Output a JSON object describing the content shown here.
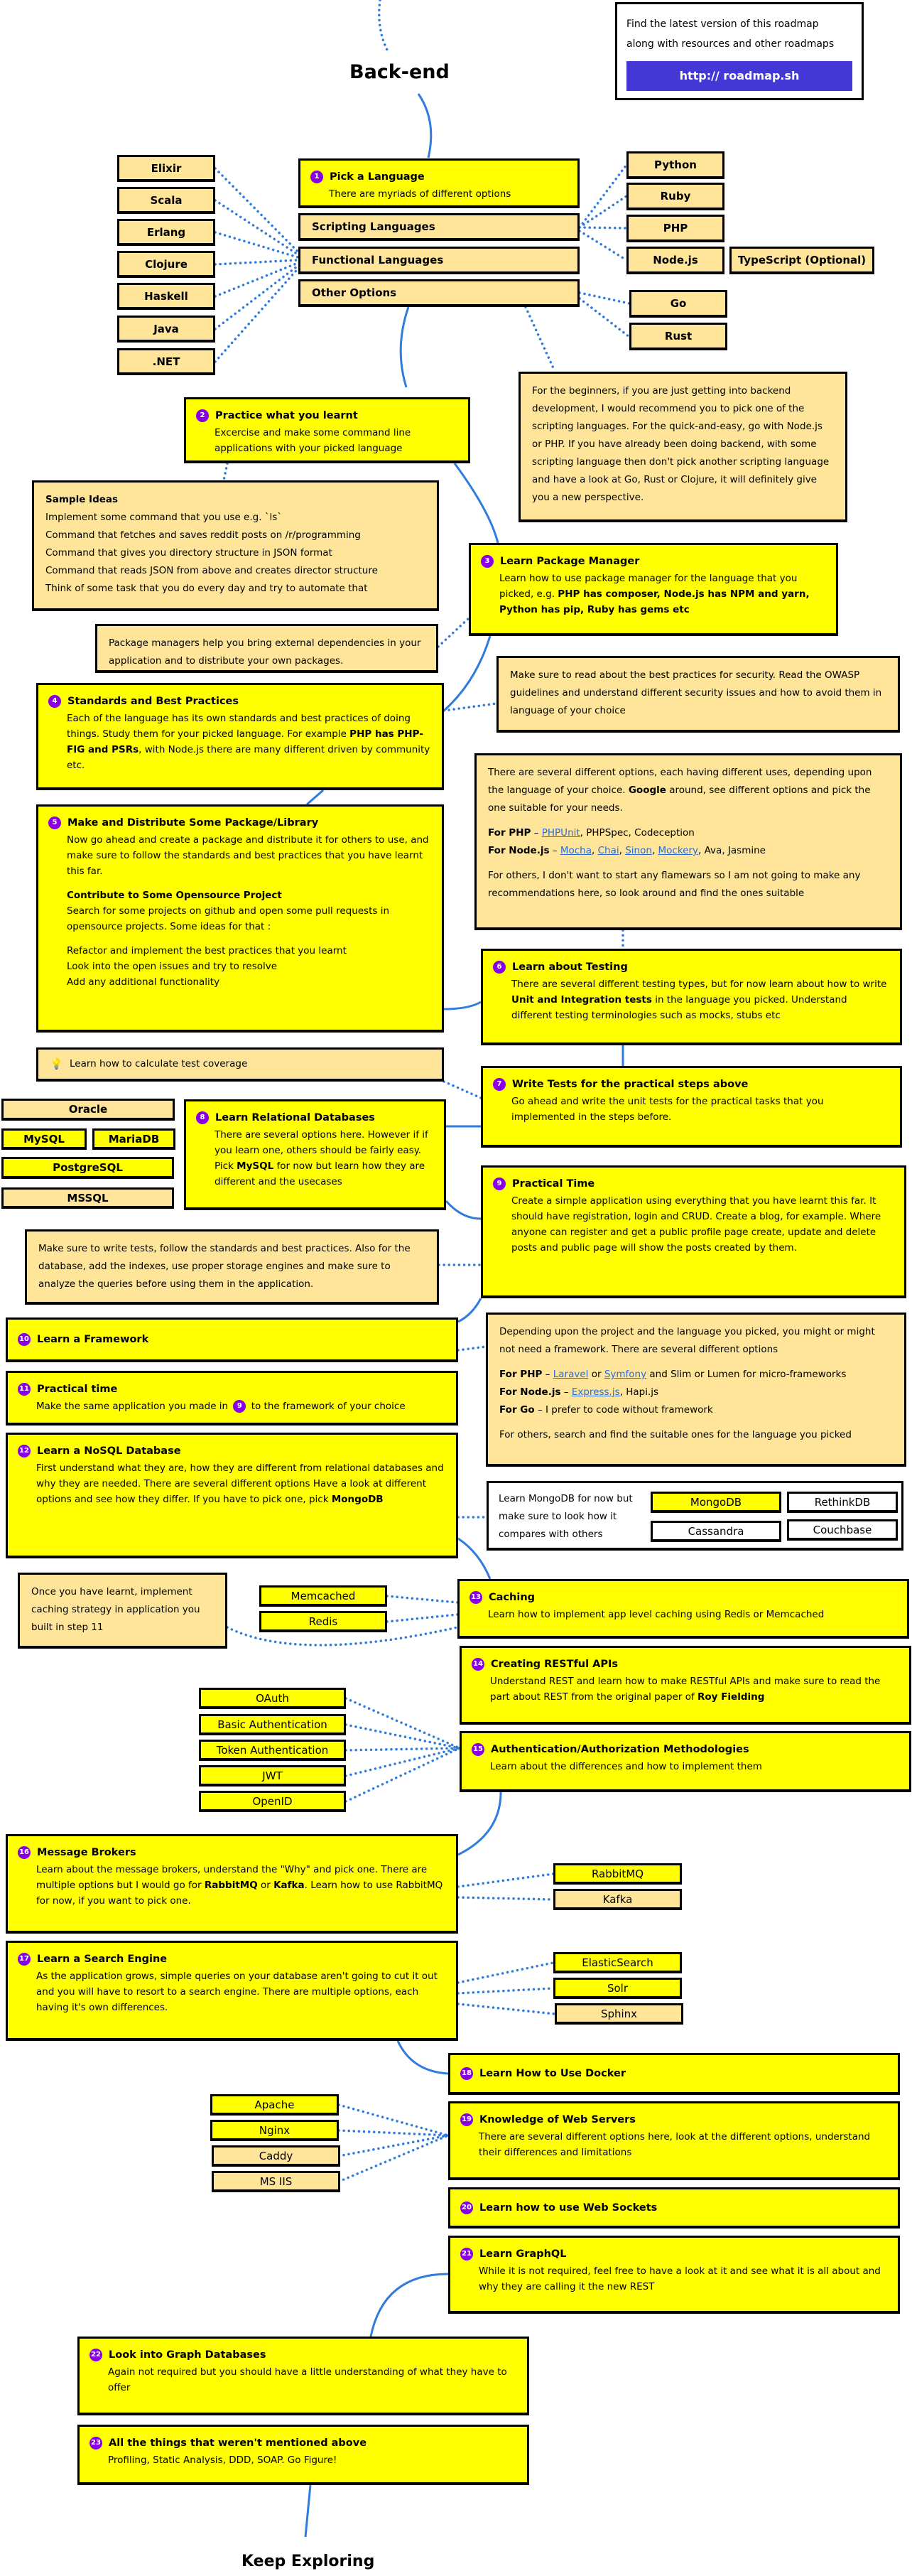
{
  "header": {
    "title": "Back-end",
    "find_text_line1": "Find the latest version of this roadmap",
    "find_text_line2": "along with resources and other roadmaps",
    "find_link": "http:// roadmap.sh"
  },
  "footer": {
    "title": "Keep Exploring"
  },
  "colors": {
    "step_yellow": "#ffff00",
    "option_beige": "#fee59a",
    "badge_purple": "#8a00e6",
    "link_blue": "#2a6bd8",
    "connector_blue": "#2f7bde",
    "banner_blue": "#4337d6"
  },
  "languages": {
    "left": [
      "Elixir",
      "Scala",
      "Erlang",
      "Clojure",
      "Haskell",
      "Java",
      ".NET"
    ],
    "categories": [
      "Scripting Languages",
      "Functional Languages",
      "Other Options"
    ],
    "right": [
      "Python",
      "Ruby",
      "PHP",
      "Node.js",
      "Go",
      "Rust"
    ],
    "typescript": "TypeScript (Optional)",
    "beginner_note": "For the beginners, if you are just getting into backend development, I would recommend you to pick one of the scripting languages. For the quick-and-easy, go with Node.js or PHP. If you have already been doing backend, with some scripting language then don't pick another scripting language and have a look at Go, Rust or Clojure, it will definitely give you a new perspective."
  },
  "steps": [
    {
      "n": "1",
      "title": "Pick a Language",
      "body": "There are myriads of different options"
    },
    {
      "n": "2",
      "title": "Practice what you learnt",
      "body": "Excercise and make some command line applications with your picked language"
    },
    {
      "n": "3",
      "title": "Learn Package Manager",
      "body_pre": "Learn how to use package manager for the language that you picked, e.g. ",
      "body_bold": "PHP has composer, Node.js has NPM and yarn, Python has pip, Ruby has gems etc"
    },
    {
      "n": "4",
      "title": "Standards and Best Practices",
      "body_pre": "Each of the language has its own standards and best practices of doing things. Study them for your picked language. For example ",
      "body_bold": "PHP has PHP-FIG and PSRs",
      "body_post": ", with Node.js there are many different driven by community etc."
    },
    {
      "n": "5",
      "title": "Make and Distribute Some Package/Library",
      "body": "Now go ahead and create a package and distribute it for others to use, and make sure to follow the standards and best practices that you have learnt this far.",
      "sub_title": "Contribute to Some Opensource Project",
      "sub_body": "Search for some projects on github and open some pull requests in opensource projects. Some ideas for that :",
      "ideas": [
        "Refactor and implement the best practices that you learnt",
        "Look into the open issues and try to resolve",
        "Add any additional functionality"
      ]
    },
    {
      "n": "6",
      "title": "Learn about Testing",
      "body_pre": "There are several different testing types, but for now learn about how to write ",
      "body_bold": "Unit and Integration tests",
      "body_post": " in the language you picked. Understand different testing terminologies such as mocks, stubs etc"
    },
    {
      "n": "7",
      "title": "Write Tests for the practical steps above",
      "body": "Go ahead and write the unit tests for the practical tasks that you implemented in the steps before."
    },
    {
      "n": "8",
      "title": "Learn Relational Databases",
      "body_pre": "There are several options here. However if if you learn one, others should be fairly easy. Pick ",
      "body_bold": "MySQL",
      "body_post": " for now but learn how they are different and the usecases"
    },
    {
      "n": "9",
      "title": "Practical Time",
      "body": "Create a simple application using everything that you have learnt this far. It should have registration, login and CRUD. Create a blog, for example. Where anyone can register and get a public profile page create, update and delete posts and public page will show the posts created by them."
    },
    {
      "n": "10",
      "title": "Learn a Framework"
    },
    {
      "n": "11",
      "title": "Practical time",
      "body_pre": "Make the same application you made in ",
      "body_ref": "9",
      "body_post": " to the framework of your choice"
    },
    {
      "n": "12",
      "title": "Learn a NoSQL Database",
      "body_pre": "First understand what they are, how they are different from relational databases and why they are needed. There are several different options Have a look at different options and see how they differ. If you have to pick one, pick ",
      "body_bold": "MongoDB"
    },
    {
      "n": "13",
      "title": "Caching",
      "body": "Learn how to implement app level caching using Redis or Memcached"
    },
    {
      "n": "14",
      "title": "Creating RESTful APIs",
      "body_pre": "Understand REST and learn how to make RESTful APIs and make sure to read the part about REST from the original paper of ",
      "body_bold": "Roy Fielding"
    },
    {
      "n": "15",
      "title": "Authentication/Authorization Methodologies",
      "body": "Learn about the differences and how to implement them"
    },
    {
      "n": "16",
      "title": "Message Brokers",
      "body_pre": "Learn about the message brokers, understand the \"Why\" and pick one. There are multiple options but I would go for ",
      "body_bold": "RabbitMQ",
      "body_mid": " or ",
      "body_bold2": "Kafka",
      "body_post": ". Learn how to use RabbitMQ for now, if you want to pick one."
    },
    {
      "n": "17",
      "title": "Learn a Search Engine",
      "body": "As the application grows, simple queries on your database aren't going to cut it out and you will have to resort to a search engine. There are multiple options, each having it's own differences."
    },
    {
      "n": "18",
      "title": "Learn How to Use Docker"
    },
    {
      "n": "19",
      "title": "Knowledge of Web Servers",
      "body": "There are several different options here, look at the different options, understand their differences and limitations"
    },
    {
      "n": "20",
      "title": "Learn how to use Web Sockets"
    },
    {
      "n": "21",
      "title": "Learn GraphQL",
      "body": "While it is not required, feel free to have a look at it and see what it is all about and why they are calling it the new REST"
    },
    {
      "n": "22",
      "title": "Look into Graph Databases",
      "body": "Again not required but you should have a little understanding of what they have to offer"
    },
    {
      "n": "23",
      "title": "All the things that weren't mentioned above",
      "body": "Profiling, Static Analysis, DDD, SOAP. Go Figure!"
    }
  ],
  "notes": {
    "sample_ideas": {
      "title": "Sample Ideas",
      "items": [
        "Implement some command that you use e.g. `ls`",
        "Command that fetches and saves reddit posts on /r/programming",
        "Command that gives you directory structure in JSON format",
        "Command that reads JSON from above and creates director structure",
        "Think of some task that you do every day and try to automate that"
      ]
    },
    "package_managers": "Package managers help you bring external dependencies in your application and to distribute your own packages.",
    "security": "Make sure to read about the best practices for security. Read the OWASP guidelines and understand different security issues and how to avoid them in language of your choice",
    "testing": {
      "intro_pre": "There are several different options, each having different uses, depending upon the language of your choice. ",
      "intro_bold": "Google",
      "intro_post": " around, see different options and pick the one suitable for your needs.",
      "php_label": "For PHP",
      "php_links": [
        "PHPUnit"
      ],
      "php_rest": ", PHPSpec, Codeception",
      "node_label": "For Node.js",
      "node_links": [
        "Mocha",
        "Chai",
        "Sinon",
        "Mockery"
      ],
      "node_rest": ", Ava, Jasmine",
      "others": "For others, I don't want to start any flamewars so I am not going to make any recommendations here, so look around and find the ones suitable"
    },
    "test_coverage": "Learn how to calculate test coverage",
    "tests_db": "Make sure to write tests, follow the standards and best practices. Also for the database, add the indexes, use proper storage engines and make sure to analyze the queries before using them in the application.",
    "framework": {
      "intro": "Depending upon the project and the language you picked, you might or might not need a framework. There are several different options",
      "php_label": "For PHP",
      "php_link1": "Laravel",
      "php_or": " or ",
      "php_link2": "Symfony",
      "php_rest": " and Slim or Lumen for micro-frameworks",
      "node_label": "For Node.js",
      "node_link": "Express.js",
      "node_rest": ", Hapi.js",
      "go_label": "For Go",
      "go_rest": " I prefer to code without framework",
      "others": "For others, search and find the suitable ones for the language you picked"
    },
    "mongo": {
      "text": "Learn MongoDB for now but make sure to look how it compares with others",
      "options": [
        "MongoDB",
        "RethinkDB",
        "Cassandra",
        "Couchbase"
      ]
    },
    "caching": "Once you have learnt, implement caching strategy in application you built in step 11"
  },
  "databases": [
    "Oracle",
    "MySQL",
    "MariaDB",
    "PostgreSQL",
    "MSSQL"
  ],
  "caches": [
    "Memcached",
    "Redis"
  ],
  "auth": [
    "OAuth",
    "Basic Authentication",
    "Token Authentication",
    "JWT",
    "OpenID"
  ],
  "brokers": [
    "RabbitMQ",
    "Kafka"
  ],
  "search_engines": [
    "ElasticSearch",
    "Solr",
    "Sphinx"
  ],
  "web_servers": [
    "Apache",
    "Nginx",
    "Caddy",
    "MS IIS"
  ]
}
